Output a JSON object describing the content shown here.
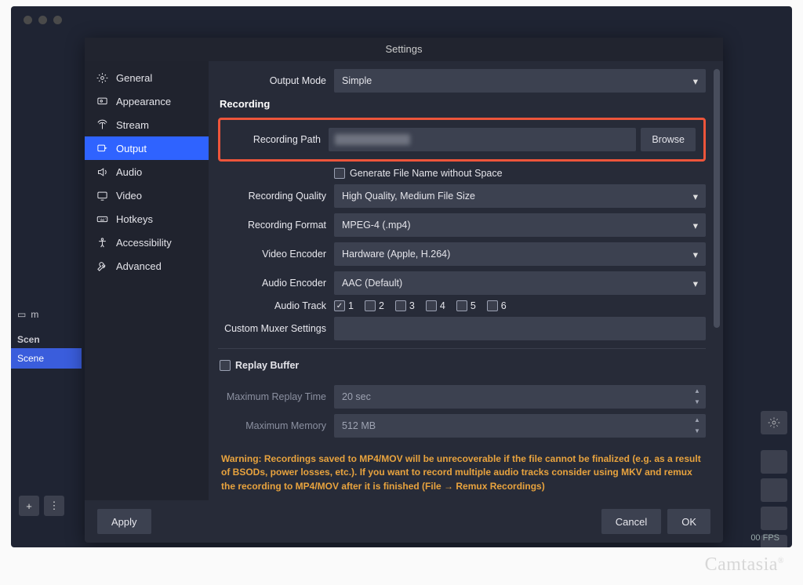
{
  "dialog_title": "Settings",
  "nav": {
    "items": [
      {
        "label": "General",
        "icon": "gear"
      },
      {
        "label": "Appearance",
        "icon": "appearance"
      },
      {
        "label": "Stream",
        "icon": "antenna"
      },
      {
        "label": "Output",
        "icon": "output"
      },
      {
        "label": "Audio",
        "icon": "speaker"
      },
      {
        "label": "Video",
        "icon": "monitor"
      },
      {
        "label": "Hotkeys",
        "icon": "keyboard"
      },
      {
        "label": "Accessibility",
        "icon": "accessibility"
      },
      {
        "label": "Advanced",
        "icon": "wrench"
      }
    ],
    "active_index": 3
  },
  "output_mode": {
    "label": "Output Mode",
    "value": "Simple"
  },
  "recording": {
    "heading": "Recording",
    "path_label": "Recording Path",
    "path_value": "",
    "browse": "Browse",
    "gen_filename": {
      "label": "Generate File Name without Space",
      "checked": false
    },
    "quality": {
      "label": "Recording Quality",
      "value": "High Quality, Medium File Size"
    },
    "format": {
      "label": "Recording Format",
      "value": "MPEG-4 (.mp4)"
    },
    "video_encoder": {
      "label": "Video Encoder",
      "value": "Hardware (Apple, H.264)"
    },
    "audio_encoder": {
      "label": "Audio Encoder",
      "value": "AAC (Default)"
    },
    "audio_track": {
      "label": "Audio Track",
      "tracks": [
        "1",
        "2",
        "3",
        "4",
        "5",
        "6"
      ],
      "checked": [
        true,
        false,
        false,
        false,
        false,
        false
      ]
    },
    "muxer": {
      "label": "Custom Muxer Settings",
      "value": ""
    }
  },
  "replay": {
    "checkbox_label": "Replay Buffer",
    "checked": false,
    "max_time": {
      "label": "Maximum Replay Time",
      "value": "20 sec"
    },
    "max_mem": {
      "label": "Maximum Memory",
      "value": "512 MB"
    }
  },
  "warning_text": "Warning: Recordings saved to MP4/MOV will be unrecoverable if the file cannot be finalized (e.g. as a result of BSODs, power losses, etc.). If you want to record multiple audio tracks consider using MKV and remux the recording to MP4/MOV after it is finished (File → Remux Recordings)",
  "footer": {
    "apply": "Apply",
    "cancel": "Cancel",
    "ok": "OK"
  },
  "background": {
    "m_label": "m",
    "scenes_label": "Scen",
    "scene_item": "Scene",
    "status": "00 FPS"
  },
  "watermark": "Camtasia"
}
